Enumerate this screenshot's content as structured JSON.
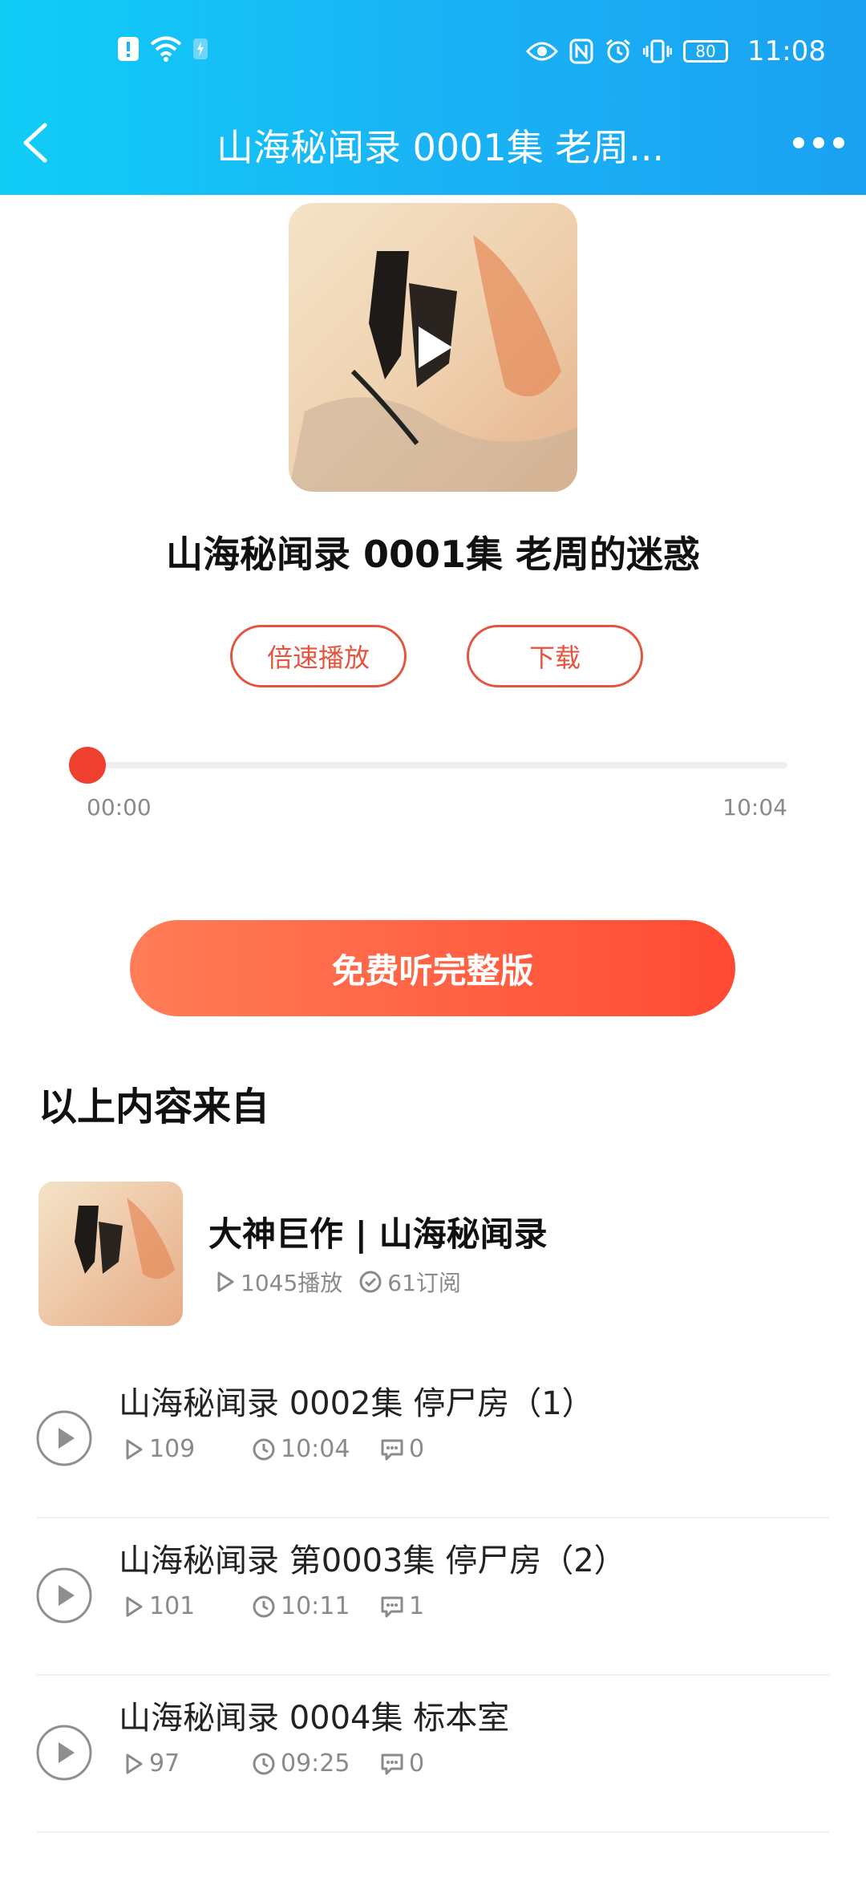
{
  "status_bar": {
    "time": "11:08",
    "battery": "80"
  },
  "nav": {
    "title": "山海秘闻录 0001集 老周..."
  },
  "player": {
    "episode_title": "山海秘闻录 0001集 老周的迷惑",
    "speed_button": "倍速播放",
    "download_button": "下载",
    "current_time": "00:00",
    "duration": "10:04",
    "progress": 0
  },
  "cta": {
    "label": "免费听完整版"
  },
  "source": {
    "heading": "以上内容来自",
    "album_name": "大神巨作 | 山海秘闻录",
    "plays": "1045播放",
    "subscribers": "61订阅"
  },
  "episodes": [
    {
      "title": "山海秘闻录 0002集 停尸房（1）",
      "plays": "109",
      "duration": "10:04",
      "comments": "0"
    },
    {
      "title": "山海秘闻录 第0003集 停尸房（2）",
      "plays": "101",
      "duration": "10:11",
      "comments": "1"
    },
    {
      "title": "山海秘闻录 0004集 标本室",
      "plays": "97",
      "duration": "09:25",
      "comments": "0"
    }
  ],
  "colors": {
    "header_start": "#10cdf6",
    "header_end": "#1aa1f1",
    "accent": "#f04a3a"
  },
  "icons": [
    "back-chevron-icon",
    "more-dots-icon",
    "play-icon",
    "play-circle-icon",
    "clock-icon",
    "comment-icon",
    "check-circle-icon",
    "eye-icon",
    "nfc-icon",
    "alarm-icon",
    "vibrate-icon",
    "wifi-icon",
    "sim-alert-icon",
    "charging-icon"
  ]
}
